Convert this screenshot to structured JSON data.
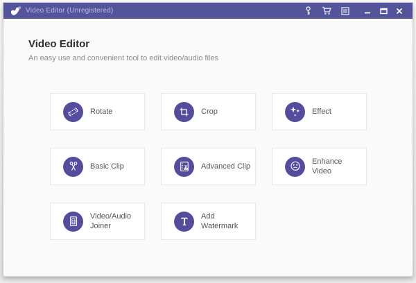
{
  "window": {
    "titlebar": {
      "title": "Video Editor (Unregistered)",
      "bar_color": "#54549b",
      "icons": [
        "key-icon",
        "cart-icon",
        "menu-icon"
      ],
      "controls": [
        "minimize",
        "maximize",
        "close"
      ]
    }
  },
  "header": {
    "title": "Video Editor",
    "subtitle": "An easy use and convenient tool to edit video/audio files"
  },
  "tools": [
    {
      "label": "Rotate",
      "icon": "rotate-icon"
    },
    {
      "label": "Crop",
      "icon": "crop-icon"
    },
    {
      "label": "Effect",
      "icon": "sparkles-icon"
    },
    {
      "label": "Basic Clip",
      "icon": "scissors-icon"
    },
    {
      "label": "Advanced Clip",
      "icon": "film-scissors-icon"
    },
    {
      "label": "Enhance Video",
      "icon": "film-reel-icon"
    },
    {
      "label": "Video/Audio Joiner",
      "icon": "film-strip-icon"
    },
    {
      "label": "Add Watermark",
      "icon": "text-t-icon"
    }
  ],
  "colors": {
    "titlebar": "#54549b",
    "tool_circle": "#544d9e",
    "window_bg": "#fafafa",
    "card_border": "#e7e7e9",
    "heading_text": "#2f2f2f",
    "subtitle_text": "#8b8b8b"
  }
}
